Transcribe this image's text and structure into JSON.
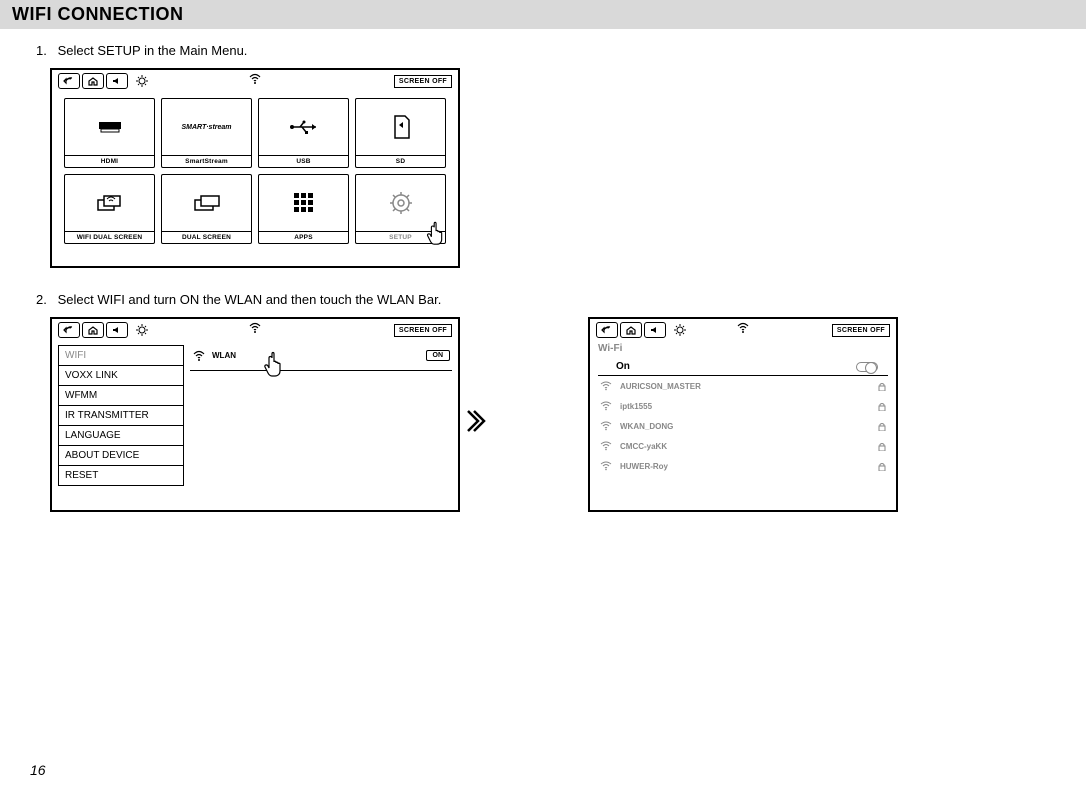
{
  "title": "WIFI CONNECTION",
  "step1": {
    "num": "1.",
    "text": "Select SETUP in the Main Menu."
  },
  "step2": {
    "num": "2.",
    "text": "Select WIFI and turn ON the WLAN and then touch the WLAN Bar."
  },
  "screen_off": "SCREEN OFF",
  "tiles": {
    "hdmi": "HDMI",
    "smartstream_label": "SmartStream",
    "smartstream_icon": "SMART·stream",
    "usb": "USB",
    "sd": "SD",
    "wifidual": "WIFI DUAL SCREEN",
    "dual": "DUAL SCREEN",
    "apps": "APPS",
    "setup": "SETUP"
  },
  "panel2": {
    "sidebar": {
      "wifi": "WIFI",
      "voxx": "VOXX LINK",
      "wfmm": "WFMM",
      "ir": "IR TRANSMITTER",
      "lang": "LANGUAGE",
      "about": "ABOUT DEVICE",
      "reset": "RESET"
    },
    "wlan": "WLAN",
    "on": "ON"
  },
  "panel3": {
    "title": "Wi-Fi",
    "on": "On",
    "nets": {
      "n1": "AURICSON_MASTER",
      "n2": "iptk1555",
      "n3": "WKAN_DONG",
      "n4": "CMCC-yaKK",
      "n5": "HUWER-Roy"
    }
  },
  "page": "16"
}
